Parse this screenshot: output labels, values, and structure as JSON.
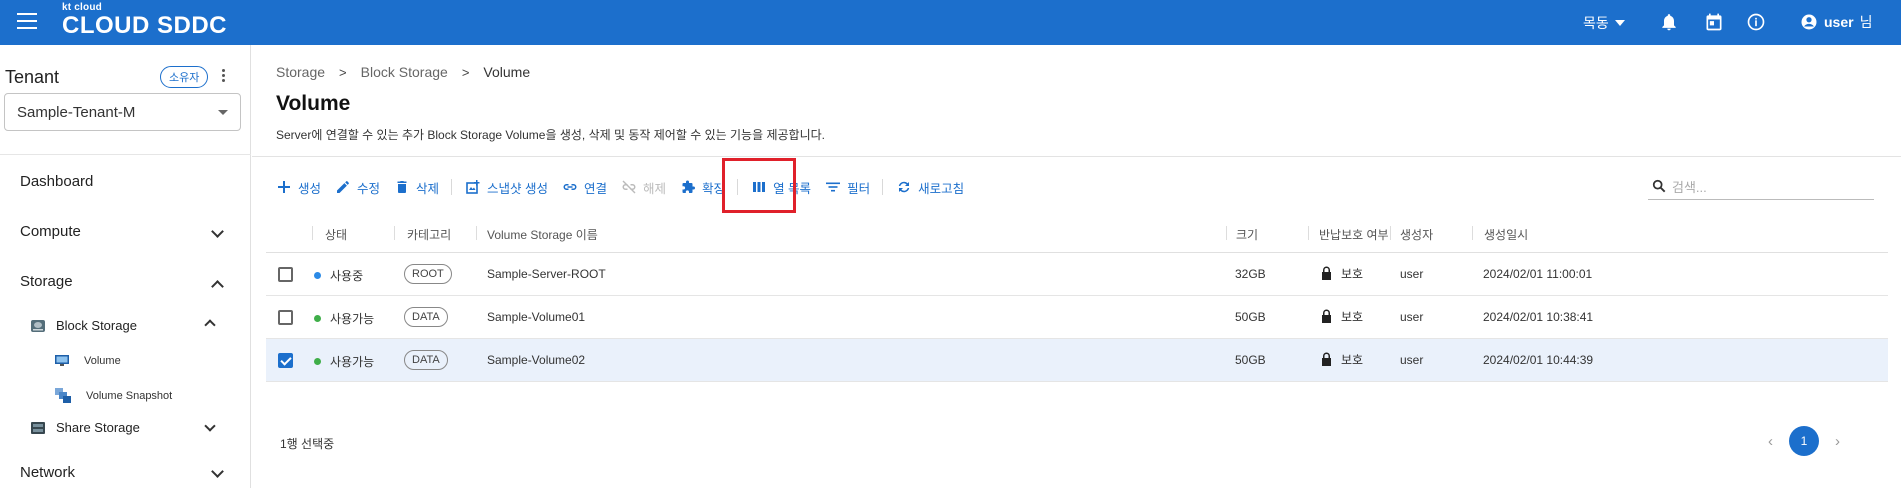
{
  "app": {
    "logo_small": "kt cloud",
    "logo_big": "CLOUD SDDC",
    "region": "목동",
    "user_name": "user",
    "user_suffix": "님"
  },
  "sidebar": {
    "tenant_title": "Tenant",
    "owner_badge": "소유자",
    "tenant_selected": "Sample-Tenant-M",
    "items": [
      {
        "label": "Dashboard"
      },
      {
        "label": "Compute"
      },
      {
        "label": "Storage"
      },
      {
        "label": "Network"
      }
    ],
    "storage_sub": [
      {
        "label": "Block Storage"
      },
      {
        "label": "Share Storage"
      }
    ],
    "block_sub": [
      {
        "label": "Volume"
      },
      {
        "label": "Volume Snapshot"
      }
    ]
  },
  "main": {
    "breadcrumb": [
      "Storage",
      "Block Storage",
      "Volume"
    ],
    "title": "Volume",
    "description": "Server에 연결할 수 있는 추가 Block Storage Volume을 생성, 삭제 및 동작 제어할 수 있는 기능을 제공합니다.",
    "toolbar": {
      "create": "생성",
      "edit": "수정",
      "delete": "삭제",
      "snapshot": "스냅샷 생성",
      "attach": "연결",
      "detach": "해제",
      "extend": "확장",
      "columns": "열 목록",
      "filter": "필터",
      "refresh": "새로고침"
    },
    "search_placeholder": "검색...",
    "columns": {
      "status": "상태",
      "category": "카테고리",
      "name": "Volume Storage 이름",
      "size": "크기",
      "protect": "반납보호 여부",
      "creator": "생성자",
      "created": "생성일시"
    },
    "rows": [
      {
        "status": "사용중",
        "status_color": "#2b8ae6",
        "category": "ROOT",
        "name": "Sample-Server-ROOT",
        "size": "32GB",
        "protect": "보호",
        "creator": "user",
        "created": "2024/02/01 11:00:01",
        "checked": false
      },
      {
        "status": "사용가능",
        "status_color": "#3fae49",
        "category": "DATA",
        "name": "Sample-Volume01",
        "size": "50GB",
        "protect": "보호",
        "creator": "user",
        "created": "2024/02/01 10:38:41",
        "checked": false
      },
      {
        "status": "사용가능",
        "status_color": "#3fae49",
        "category": "DATA",
        "name": "Sample-Volume02",
        "size": "50GB",
        "protect": "보호",
        "creator": "user",
        "created": "2024/02/01 10:44:39",
        "checked": true
      }
    ],
    "selection_text": "1행 선택중",
    "current_page": "1"
  }
}
